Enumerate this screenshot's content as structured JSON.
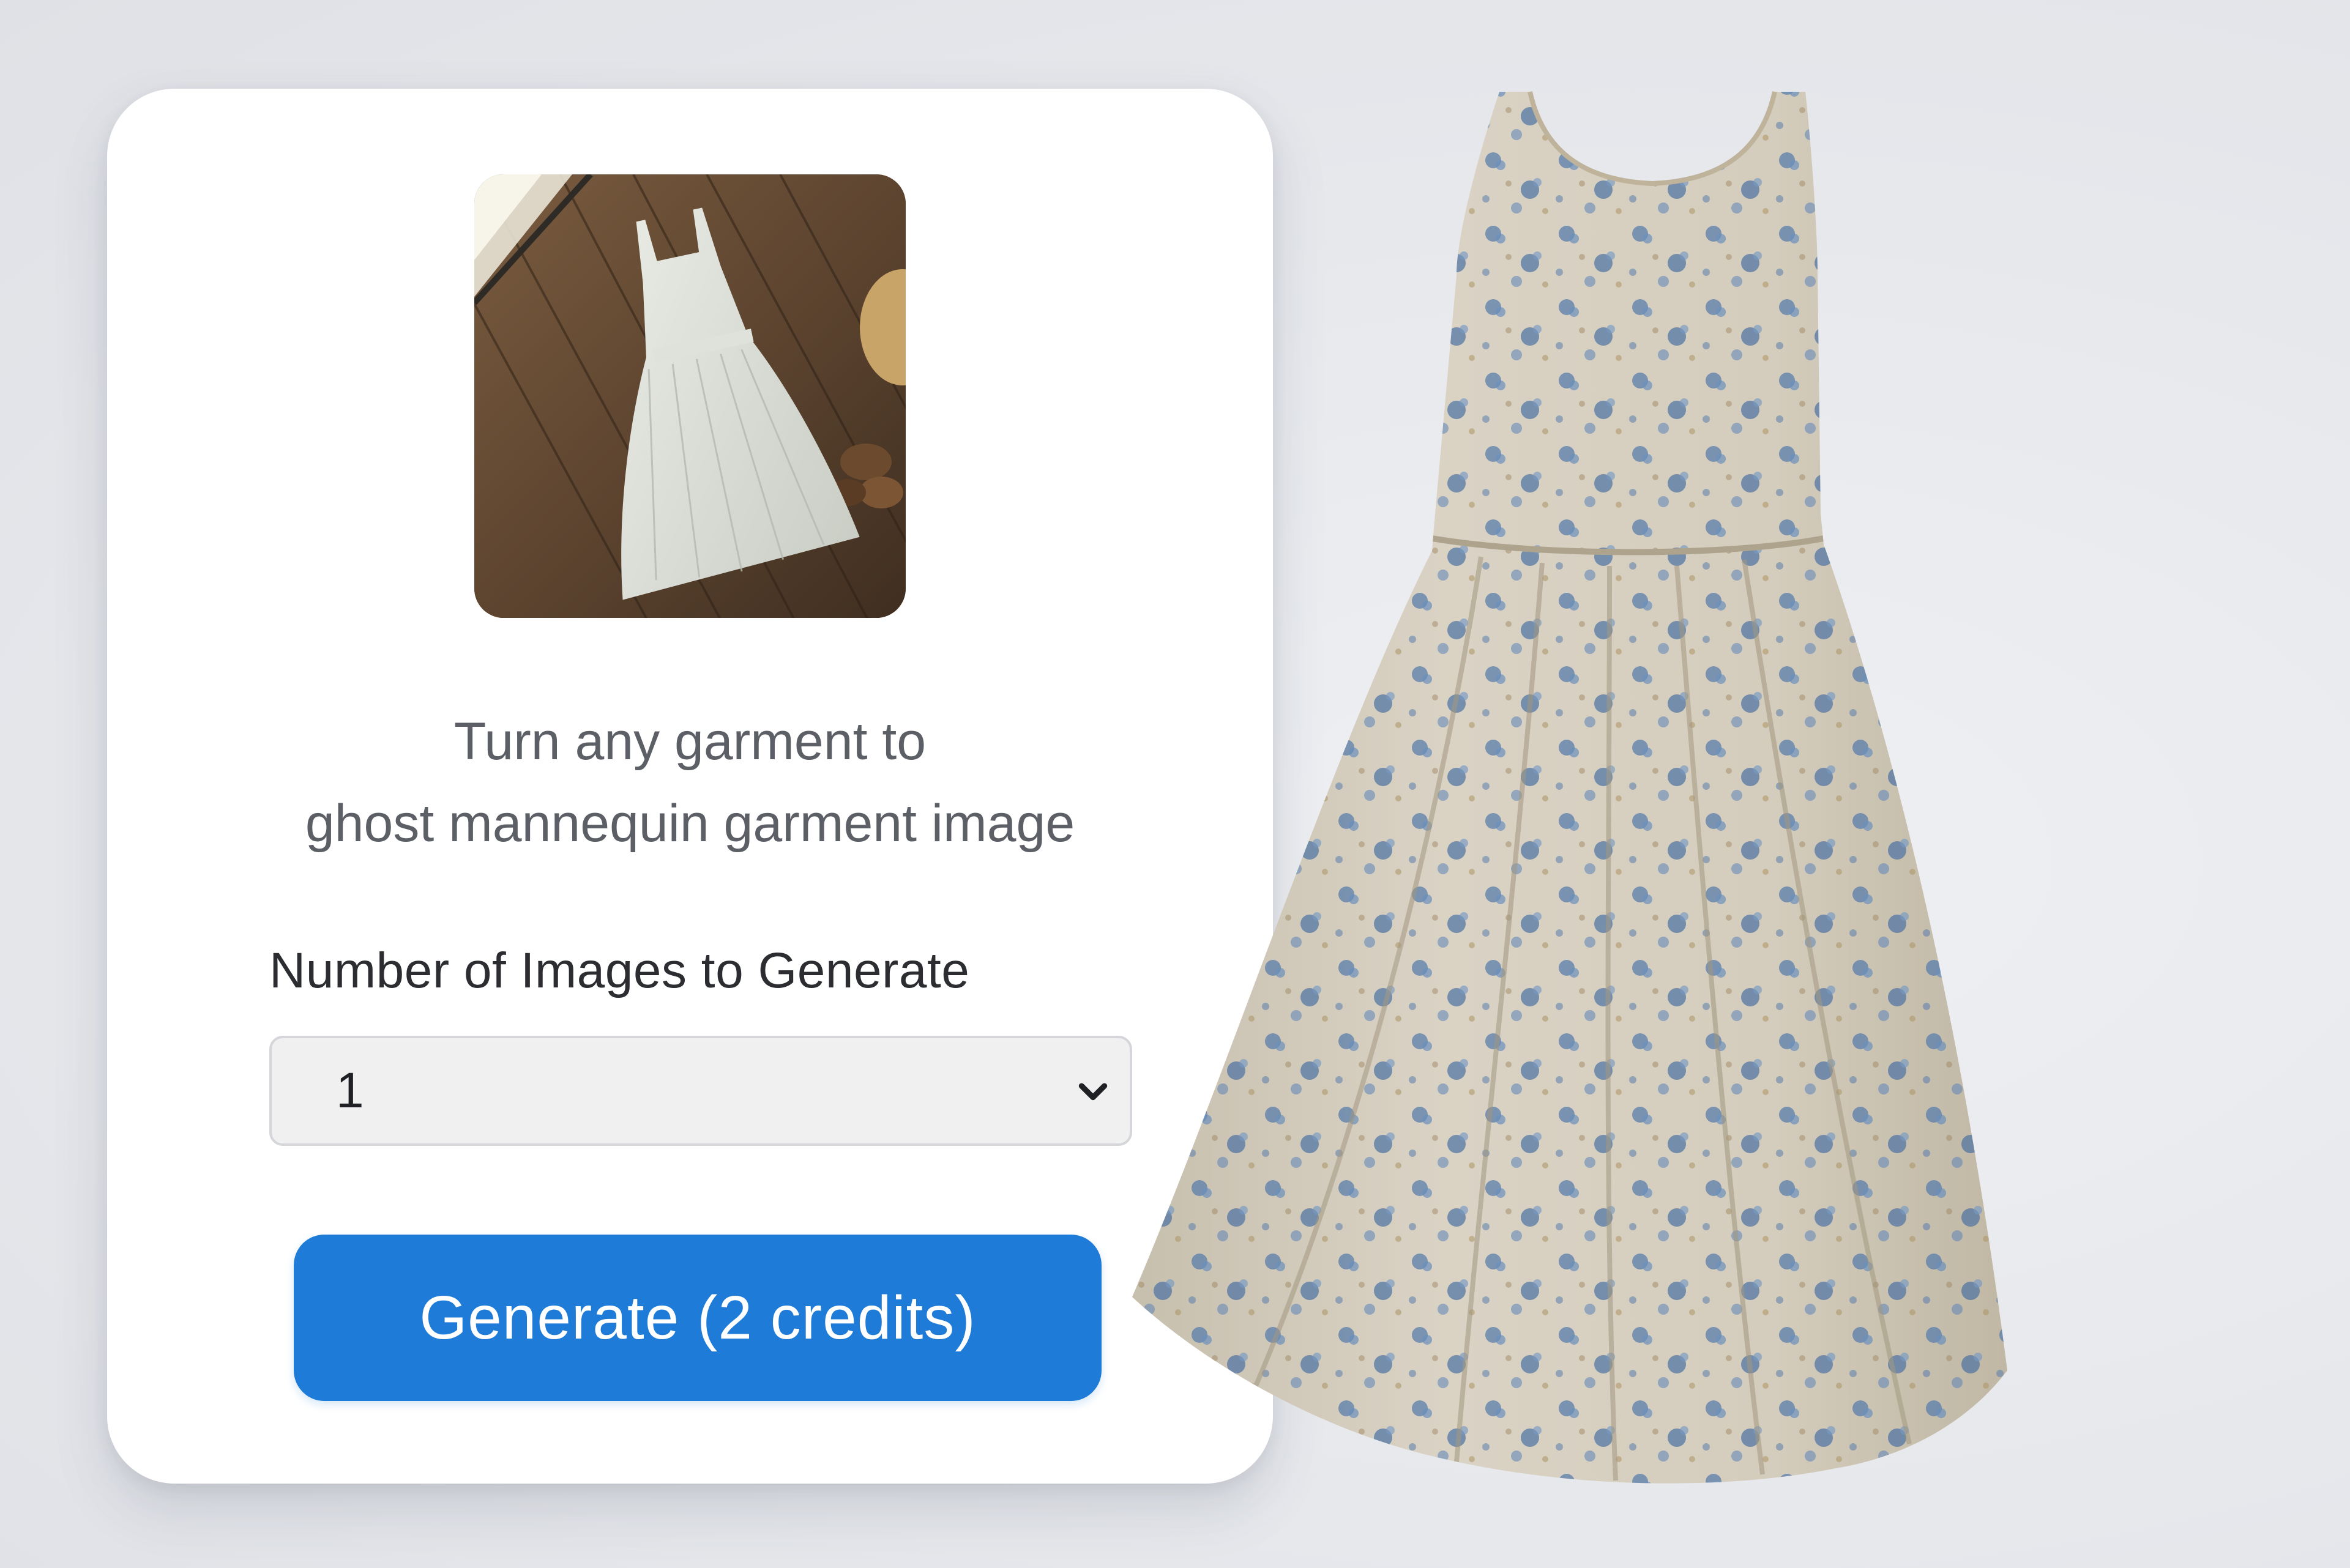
{
  "card": {
    "tagline_line1": "Turn any garment to",
    "tagline_line2": "ghost mannequin garment image",
    "count_label": "Number of Images to Generate",
    "count_value": "1",
    "generate_label": "Generate (2 credits)"
  },
  "colors": {
    "accent": "#1e7bd8",
    "card_bg": "#ffffff",
    "page_bg": "#e6e8ec",
    "dress_fabric": "#ddd5c6",
    "dress_print": "#5d82b3"
  },
  "icons": {
    "select_arrow": "chevron-down-icon"
  }
}
